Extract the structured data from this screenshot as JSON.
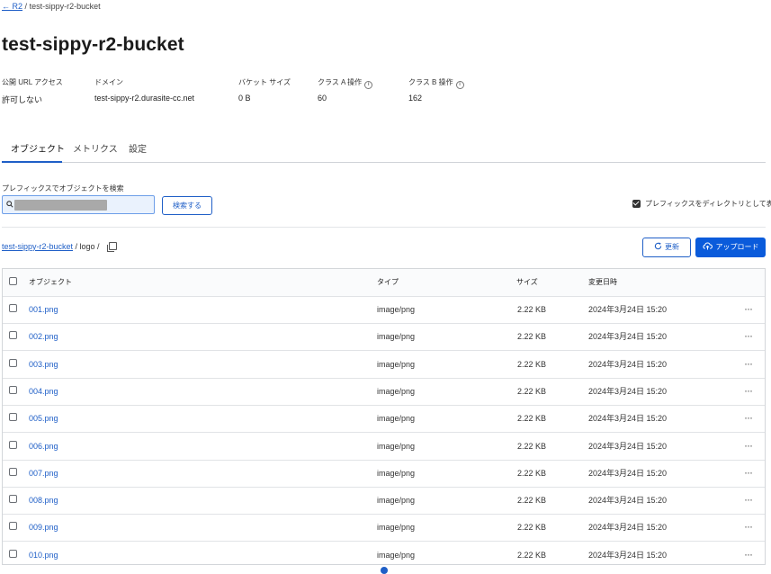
{
  "breadcrumb": {
    "back_label": "← R2",
    "separator": "/",
    "current": "test-sippy-r2-bucket"
  },
  "page_title": "test-sippy-r2-bucket",
  "meta": {
    "public_url_label": "公開 URL アクセス",
    "public_url_value": "許可しない",
    "domain_label": "ドメイン",
    "domain_value": "test-sippy-r2.durasite-cc.net",
    "bucket_size_label": "バケット サイズ",
    "bucket_size_value": "0 B",
    "class_a_label": "クラス A 操作",
    "class_a_value": "60",
    "class_b_label": "クラス B 操作",
    "class_b_value": "162",
    "info_glyph": "i"
  },
  "tabs": [
    {
      "label": "オブジェクト",
      "active": true
    },
    {
      "label": "メトリクス",
      "active": false
    },
    {
      "label": "設定",
      "active": false
    }
  ],
  "search": {
    "label": "プレフィックスでオブジェクトを検索",
    "value": "",
    "button_label": "検索する"
  },
  "prefix_option": {
    "label": "プレフィックスをディレクトリとして表示",
    "checked": true
  },
  "path": {
    "bucket": "test-sippy-r2-bucket",
    "rest": " / logo / "
  },
  "buttons": {
    "refresh": "更新",
    "upload": "アップロード"
  },
  "icons": {
    "refresh": "refresh-icon",
    "upload": "cloud-upload-icon",
    "copy": "copy-icon",
    "search": "search-icon",
    "menu": "more-horizontal-icon"
  },
  "table": {
    "headers": {
      "object": "オブジェクト",
      "type": "タイプ",
      "size": "サイズ",
      "modified": "変更日時"
    },
    "rows": [
      {
        "name": "001.png",
        "type": "image/png",
        "size": "2.22 KB",
        "modified": "2024年3月24日 15:20"
      },
      {
        "name": "002.png",
        "type": "image/png",
        "size": "2.22 KB",
        "modified": "2024年3月24日 15:20"
      },
      {
        "name": "003.png",
        "type": "image/png",
        "size": "2.22 KB",
        "modified": "2024年3月24日 15:20"
      },
      {
        "name": "004.png",
        "type": "image/png",
        "size": "2.22 KB",
        "modified": "2024年3月24日 15:20"
      },
      {
        "name": "005.png",
        "type": "image/png",
        "size": "2.22 KB",
        "modified": "2024年3月24日 15:20"
      },
      {
        "name": "006.png",
        "type": "image/png",
        "size": "2.22 KB",
        "modified": "2024年3月24日 15:20"
      },
      {
        "name": "007.png",
        "type": "image/png",
        "size": "2.22 KB",
        "modified": "2024年3月24日 15:20"
      },
      {
        "name": "008.png",
        "type": "image/png",
        "size": "2.22 KB",
        "modified": "2024年3月24日 15:20"
      },
      {
        "name": "009.png",
        "type": "image/png",
        "size": "2.22 KB",
        "modified": "2024年3月24日 15:20"
      },
      {
        "name": "010.png",
        "type": "image/png",
        "size": "2.22 KB",
        "modified": "2024年3月24日 15:20"
      }
    ],
    "row_menu": "···"
  },
  "colors": {
    "accent": "#1f5fc7",
    "primary_button": "#0a5bdb"
  }
}
